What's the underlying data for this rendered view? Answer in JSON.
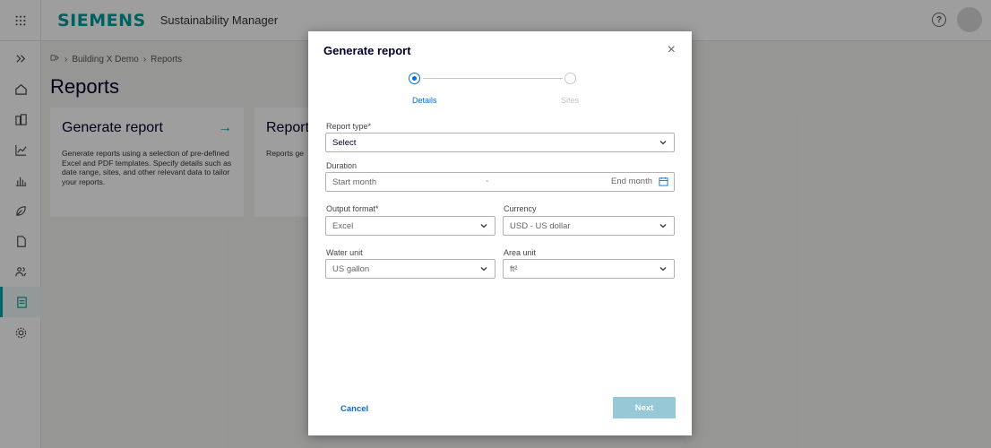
{
  "header": {
    "brand": "SIEMENS",
    "app_title": "Sustainability Manager",
    "help_icon": "?"
  },
  "breadcrumb": {
    "items": [
      "Building X Demo",
      "Reports"
    ]
  },
  "page": {
    "title": "Reports"
  },
  "cards": [
    {
      "title": "Generate report",
      "arrow": "→",
      "description": "Generate reports using a selection of pre-defined Excel and PDF templates. Specify details such as date range, sites, and other relevant data to tailor your reports."
    },
    {
      "title": "Report h",
      "description": "Reports ge"
    }
  ],
  "modal": {
    "title": "Generate report",
    "close": "×",
    "steps": [
      "Details",
      "Sites"
    ],
    "report_type": {
      "label": "Report type*",
      "value": "Select"
    },
    "duration": {
      "label": "Duration",
      "start_placeholder": "Start month",
      "separator": "-",
      "end_placeholder": "End month"
    },
    "output_format": {
      "label": "Output format*",
      "value": "Excel"
    },
    "currency": {
      "label": "Currency",
      "value": "USD - US dollar"
    },
    "water_unit": {
      "label": "Water unit",
      "value": "US gallon"
    },
    "area_unit": {
      "label": "Area unit",
      "value": "ft²"
    },
    "cancel_label": "Cancel",
    "next_label": "Next"
  },
  "colors": {
    "brand": "#009999",
    "accent": "#0a6ed1",
    "next_disabled": "#96c8d5"
  }
}
